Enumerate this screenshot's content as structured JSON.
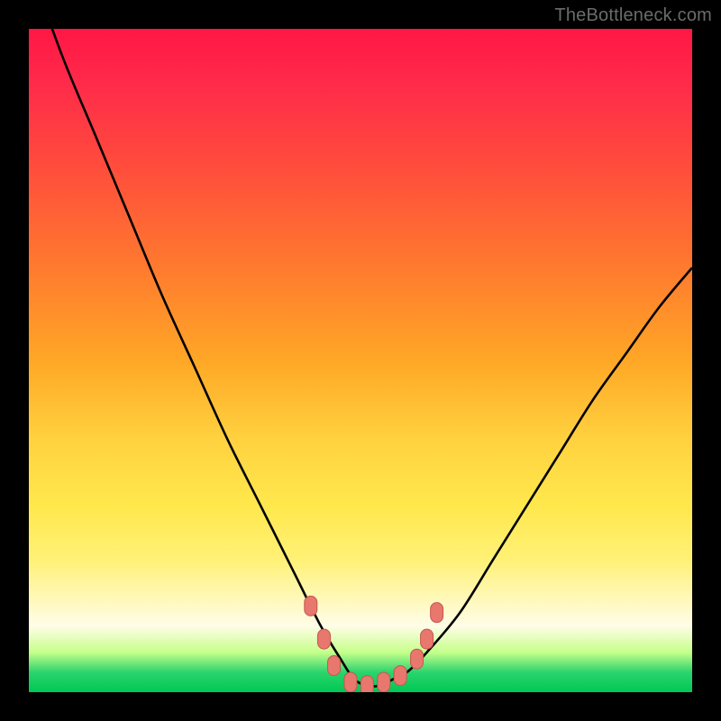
{
  "watermark": "TheBottleneck.com",
  "colors": {
    "frame": "#000000",
    "curve": "#000000",
    "marker_fill": "#e8776e",
    "marker_stroke": "#c4584f",
    "gradient_top": "#ff1744",
    "gradient_mid": "#ffd23f",
    "gradient_bottom": "#00c853"
  },
  "chart_data": {
    "type": "line",
    "title": "",
    "xlabel": "",
    "ylabel": "",
    "xlim": [
      0,
      100
    ],
    "ylim": [
      0,
      100
    ],
    "grid": false,
    "legend": null,
    "series": [
      {
        "name": "bottleneck-curve",
        "x": [
          0,
          5,
          10,
          15,
          20,
          25,
          30,
          35,
          40,
          44,
          47,
          49,
          51,
          53,
          55,
          57,
          60,
          65,
          70,
          75,
          80,
          85,
          90,
          95,
          100
        ],
        "y": [
          110,
          96,
          84,
          72,
          60,
          49,
          38,
          28,
          18,
          10,
          5,
          2,
          1,
          1,
          2,
          3,
          6,
          12,
          20,
          28,
          36,
          44,
          51,
          58,
          64
        ]
      }
    ],
    "markers": [
      {
        "x": 42.5,
        "y": 13
      },
      {
        "x": 44.5,
        "y": 8
      },
      {
        "x": 46.0,
        "y": 4
      },
      {
        "x": 48.5,
        "y": 1.5
      },
      {
        "x": 51.0,
        "y": 1
      },
      {
        "x": 53.5,
        "y": 1.5
      },
      {
        "x": 56.0,
        "y": 2.5
      },
      {
        "x": 58.5,
        "y": 5
      },
      {
        "x": 60.0,
        "y": 8
      },
      {
        "x": 61.5,
        "y": 12
      }
    ]
  }
}
